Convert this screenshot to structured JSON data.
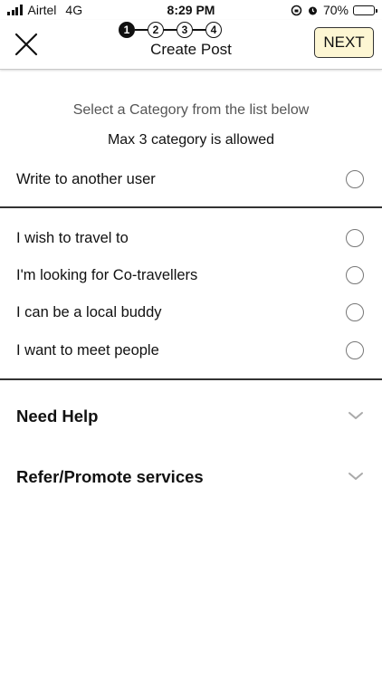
{
  "status_bar": {
    "carrier": "Airtel",
    "network": "4G",
    "time": "8:29 PM",
    "battery": "70%",
    "battery_level": 0.7
  },
  "header": {
    "title": "Create Post",
    "steps": [
      "1",
      "2",
      "3",
      "4"
    ],
    "active_step": 1,
    "next_label": "NEXT"
  },
  "instructions": {
    "line1": "Select a Category from the list below",
    "line2": "Max 3 category is allowed"
  },
  "options_primary": [
    {
      "label": "Write to another user",
      "selected": false
    }
  ],
  "options_travel": [
    {
      "label": "I wish to travel to",
      "selected": false
    },
    {
      "label": "I'm looking for Co-travellers",
      "selected": false
    },
    {
      "label": "I can be a local buddy",
      "selected": false
    },
    {
      "label": "I want to meet people",
      "selected": false
    }
  ],
  "sections": [
    {
      "label": "Need Help"
    },
    {
      "label": "Refer/Promote services"
    }
  ],
  "colors": {
    "next_bg": "#fdf6d3",
    "battery_fill": "#f4c21b"
  }
}
